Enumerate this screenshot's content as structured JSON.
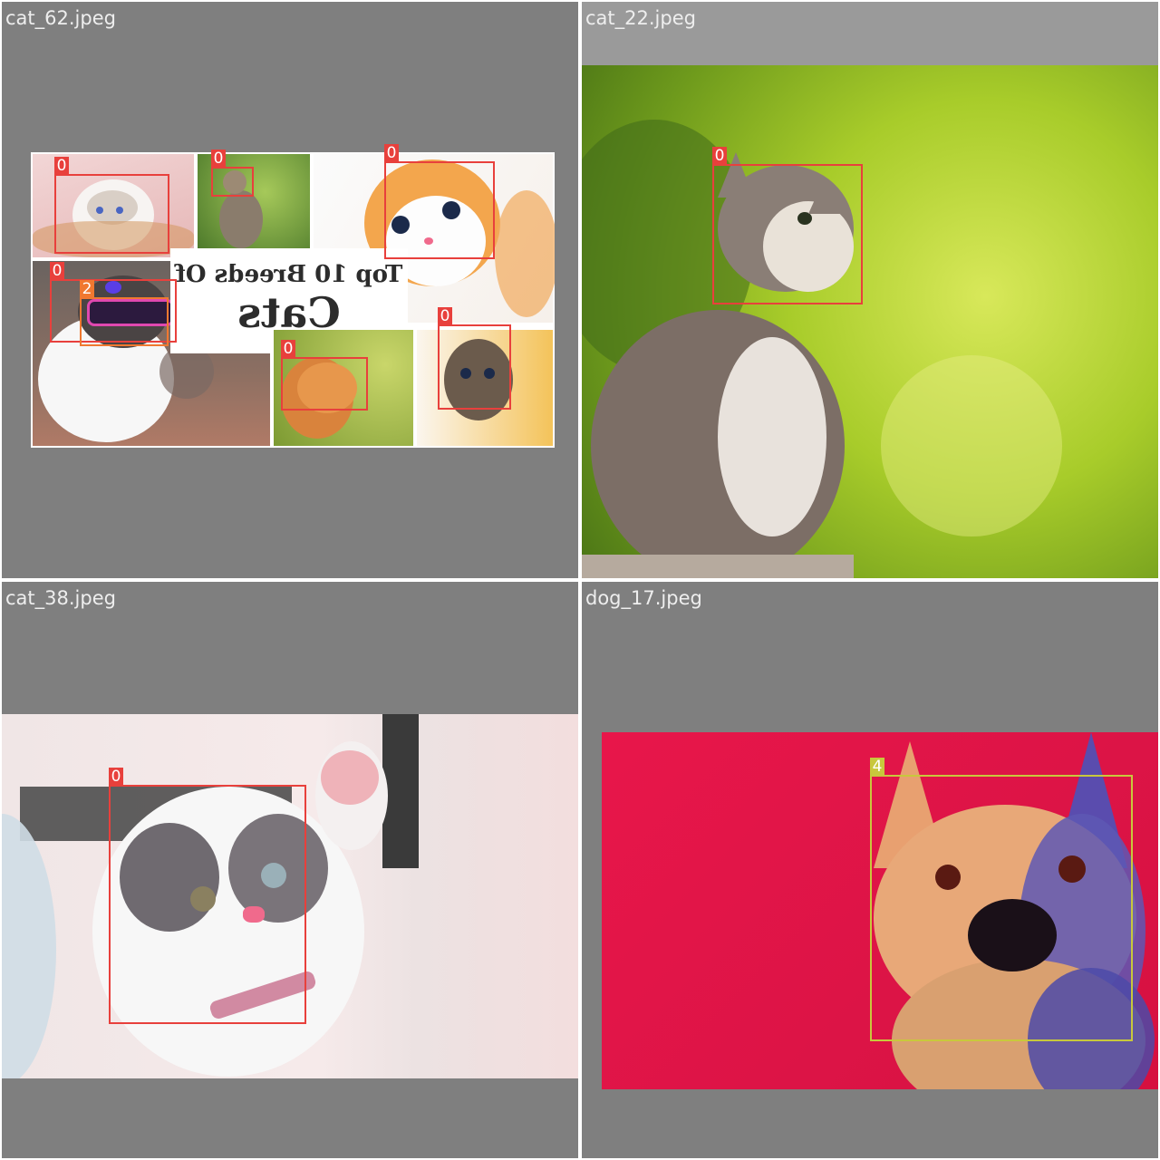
{
  "tiles": [
    {
      "filename": "cat_62.jpeg",
      "collage_title_line1": "Top 10 Breeds Of",
      "collage_title_line2": "Cats",
      "detections": [
        {
          "label": "0",
          "color": "#e8403c"
        },
        {
          "label": "0",
          "color": "#e8403c"
        },
        {
          "label": "0",
          "color": "#e8403c"
        },
        {
          "label": "0",
          "color": "#e8403c"
        },
        {
          "label": "2",
          "color": "#f07830"
        },
        {
          "label": "0",
          "color": "#e8403c"
        },
        {
          "label": "0",
          "color": "#e8403c"
        }
      ]
    },
    {
      "filename": "cat_22.jpeg",
      "detections": [
        {
          "label": "0",
          "color": "#e8403c"
        }
      ]
    },
    {
      "filename": "cat_38.jpeg",
      "detections": [
        {
          "label": "0",
          "color": "#e8403c"
        }
      ]
    },
    {
      "filename": "dog_17.jpeg",
      "detections": [
        {
          "label": "4",
          "color": "#c8c83c"
        }
      ]
    }
  ]
}
